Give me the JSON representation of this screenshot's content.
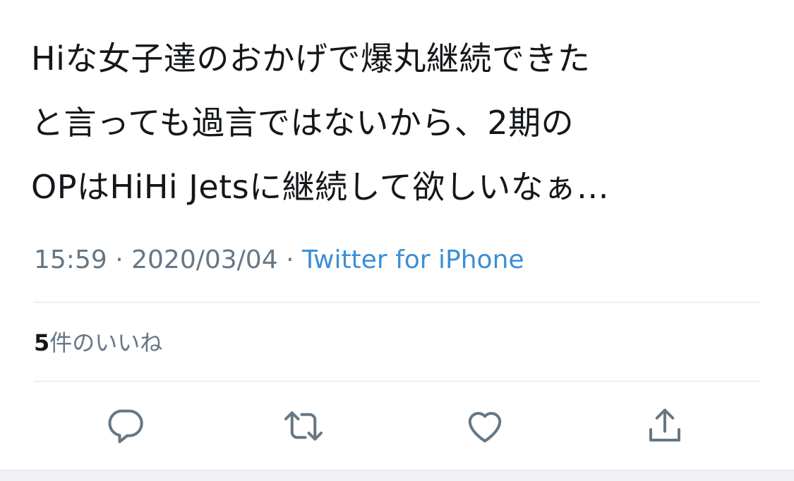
{
  "tweet": {
    "lines": [
      "Hiな女子達のおかげで爆丸継続できた",
      "と言っても過言ではないから、2期の",
      "OPはHiHi Jetsに継続して欲しいなぁ…"
    ],
    "time": "15:59",
    "separator": "·",
    "date": "2020/03/04",
    "source": "Twitter for iPhone"
  },
  "likes": {
    "count": "5",
    "label": "件のいいね"
  },
  "actions": {
    "reply_icon": "speech-bubble-icon",
    "retweet_icon": "retweet-arrows-icon",
    "like_icon": "heart-outline-icon",
    "share_icon": "share-upload-icon"
  },
  "colors": {
    "text": "#14171a",
    "secondary": "#657786",
    "link": "#3a8fd6",
    "icon": "#657786",
    "divider": "#dfe3e7"
  }
}
